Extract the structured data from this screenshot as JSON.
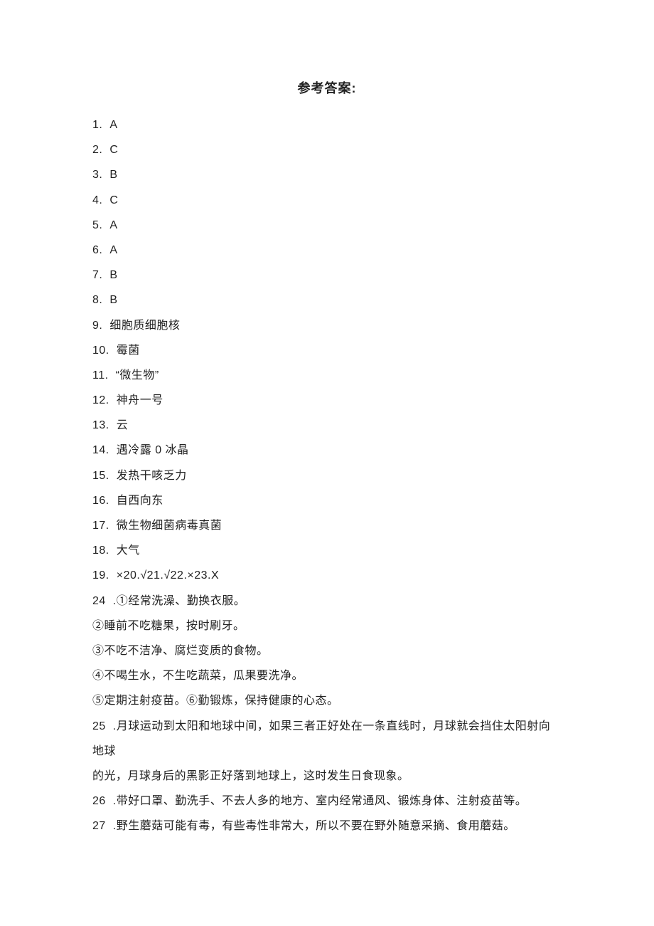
{
  "title": "参考答案:",
  "answers_numbered": [
    {
      "n": "1.",
      "t": "A"
    },
    {
      "n": "2.",
      "t": "C"
    },
    {
      "n": "3.",
      "t": "B"
    },
    {
      "n": "4.",
      "t": "C"
    },
    {
      "n": "5.",
      "t": "A"
    },
    {
      "n": "6.",
      "t": "A"
    },
    {
      "n": "7.",
      "t": "B"
    },
    {
      "n": "8.",
      "t": "B"
    },
    {
      "n": "9.",
      "t": "细胞质细胞核"
    },
    {
      "n": "10.",
      "t": "霉菌"
    },
    {
      "n": "11.",
      "t": "“微生物”"
    },
    {
      "n": "12.",
      "t": "神舟一号"
    },
    {
      "n": "13.",
      "t": "云"
    },
    {
      "n": "14.",
      "t": "遇冷露 0 冰晶"
    },
    {
      "n": "15.",
      "t": "发热干咳乏力"
    },
    {
      "n": "16.",
      "t": "自西向东"
    },
    {
      "n": "17.",
      "t": "微生物细菌病毒真菌"
    },
    {
      "n": "18.",
      "t": "大气"
    },
    {
      "n": "19.",
      "t": "×20.√21.√22.×23.X"
    }
  ],
  "q24": {
    "n": "24",
    "lead": ".①经常洗澡、勤换衣服。",
    "lines": [
      "②睡前不吃糖果，按时刷牙。",
      "③不吃不洁净、腐烂变质的食物。",
      "④不喝生水，不生吃蔬菜，瓜果要洗净。",
      "⑤定期注射疫苗。⑥勤锻炼，保持健康的心态。"
    ]
  },
  "q25": {
    "n": "25",
    "line1": ".月球运动到太阳和地球中间，如果三者正好处在一条直线时，月球就会挡住太阳射向地球",
    "line2": "的光，月球身后的黑影正好落到地球上，这时发生日食现象。"
  },
  "q26": {
    "n": "26",
    "t": ".带好口罩、勤洗手、不去人多的地方、室内经常通风、锻炼身体、注射疫苗等。"
  },
  "q27": {
    "n": "27",
    "t": ".野生蘑菇可能有毒，有些毒性非常大，所以不要在野外随意采摘、食用蘑菇。"
  }
}
